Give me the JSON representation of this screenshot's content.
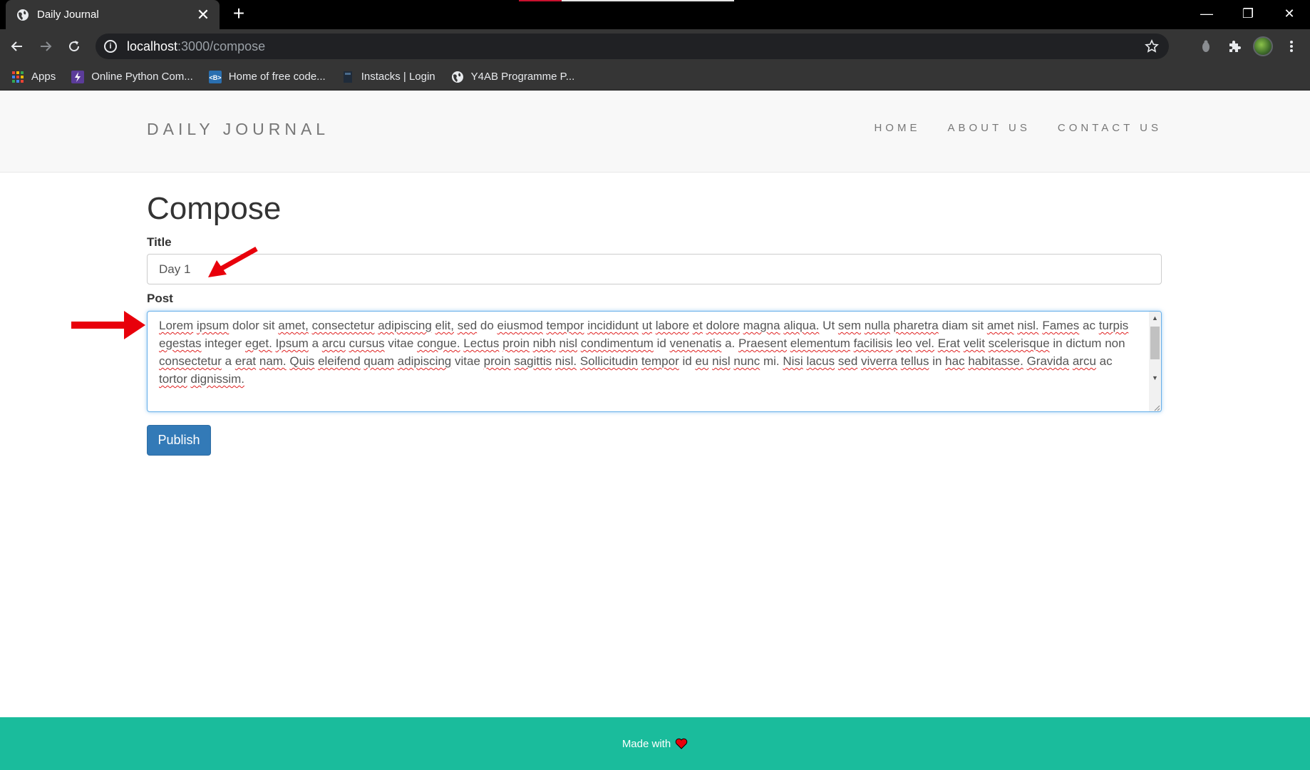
{
  "browser": {
    "tab_title": "Daily Journal",
    "tab_close": "✕",
    "new_tab": "+",
    "url_host": "localhost",
    "url_path": ":3000/compose",
    "window_controls": [
      "—",
      "❐",
      "✕"
    ],
    "bookmarks": [
      {
        "label": "Apps",
        "icon": "apps-grid-icon"
      },
      {
        "label": "Online Python Com...",
        "icon": "bolt-icon"
      },
      {
        "label": "Home of free code...",
        "icon": "code-icon"
      },
      {
        "label": "Instacks | Login",
        "icon": "bookmark-page-icon"
      },
      {
        "label": "Y4AB Programme P...",
        "icon": "globe-icon"
      }
    ]
  },
  "header": {
    "brand": "DAILY JOURNAL",
    "nav": [
      "HOME",
      "ABOUT US",
      "CONTACT US"
    ]
  },
  "compose": {
    "heading": "Compose",
    "title_label": "Title",
    "title_value": "Day 1",
    "post_label": "Post",
    "post_value": "Lorem ipsum dolor sit amet, consectetur adipiscing elit, sed do eiusmod tempor incididunt ut labore et dolore magna aliqua. Ut sem nulla pharetra diam sit amet nisl. Fames ac turpis egestas integer eget. Ipsum a arcu cursus vitae congue. Lectus proin nibh nisl condimentum id venenatis a. Praesent elementum facilisis leo vel. Erat velit scelerisque in dictum non consectetur a erat nam. Quis eleifend quam adipiscing vitae proin sagittis nisl. Sollicitudin tempor id eu nisl nunc mi. Nisi lacus sed viverra tellus in hac habitasse. Gravida arcu ac tortor dignissim.",
    "publish_label": "Publish"
  },
  "footer": {
    "text": "Made with"
  },
  "colors": {
    "footer_bg": "#1abc9c",
    "publish_bg": "#337ab7",
    "annotation_arrow": "#e8000b",
    "heart": "#e8000b"
  }
}
